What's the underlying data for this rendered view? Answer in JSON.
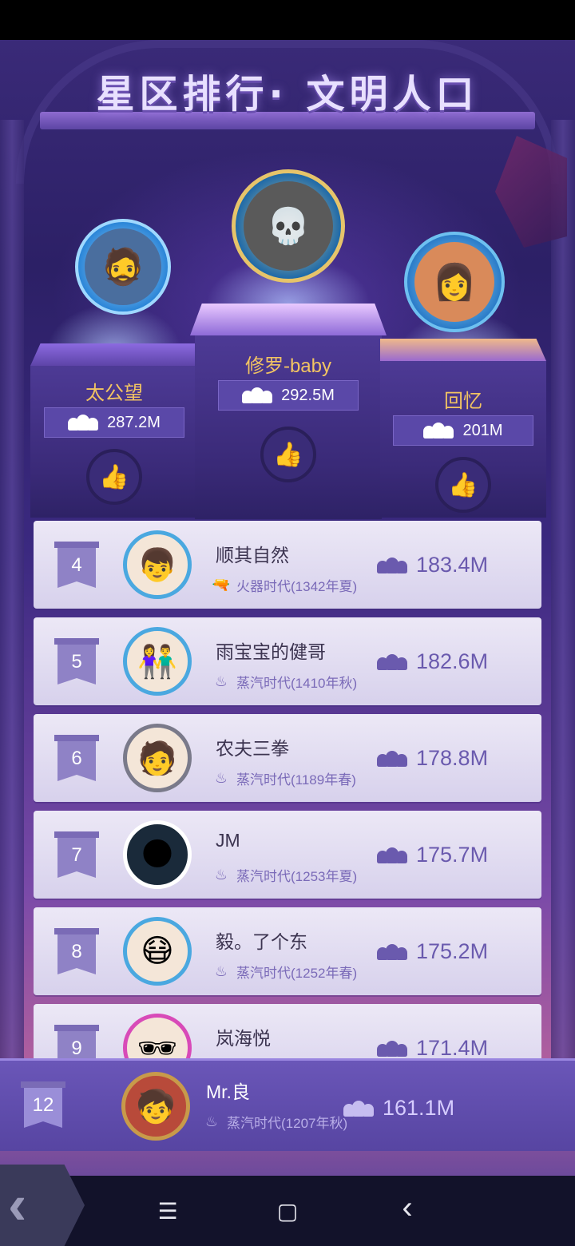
{
  "title": "星区排行· 文明人口",
  "podium": [
    {
      "rank": 2,
      "name": "太公望",
      "score": "287.2M",
      "avatar_glyph": "🧔",
      "name_color": "#f2c462"
    },
    {
      "rank": 1,
      "name": "修罗-baby",
      "score": "292.5M",
      "avatar_glyph": "💀",
      "name_color": "#f2c462"
    },
    {
      "rank": 3,
      "name": "回忆",
      "score": "201M",
      "avatar_glyph": "👩",
      "name_color": "#f2c462"
    }
  ],
  "list": [
    {
      "rank": "4",
      "name": "顺其自然",
      "era": "火器时代(1342年夏)",
      "era_icon": "gun-icon",
      "era_glyph": "🔫",
      "score": "183.4M",
      "avatar_glyph": "👦"
    },
    {
      "rank": "5",
      "name": "雨宝宝的健哥",
      "era": "蒸汽时代(1410年秋)",
      "era_icon": "steam-icon",
      "era_glyph": "♨",
      "score": "182.6M",
      "avatar_glyph": "👫"
    },
    {
      "rank": "6",
      "name": "农夫三拳",
      "era": "蒸汽时代(1189年春)",
      "era_icon": "steam-icon",
      "era_glyph": "♨",
      "score": "178.8M",
      "avatar_glyph": "🧑"
    },
    {
      "rank": "7",
      "name": "JM",
      "era": "蒸汽时代(1253年夏)",
      "era_icon": "steam-icon",
      "era_glyph": "♨",
      "score": "175.7M",
      "avatar_glyph": "🌑"
    },
    {
      "rank": "8",
      "name": "毅。了个东",
      "era": "蒸汽时代(1252年春)",
      "era_icon": "steam-icon",
      "era_glyph": "♨",
      "score": "175.2M",
      "avatar_glyph": "😷"
    },
    {
      "rank": "9",
      "name": "岚海悦",
      "era": "",
      "era_icon": "",
      "era_glyph": "",
      "score": "171.4M",
      "avatar_glyph": "🕶"
    }
  ],
  "self": {
    "rank": "12",
    "name": "Mr.良",
    "era": "蒸汽时代(1207年秋)",
    "era_icon": "steam-icon",
    "era_glyph": "♨",
    "score": "161.1M",
    "avatar_glyph": "🧒"
  },
  "nav": {
    "menu": "☰",
    "home": "▢",
    "back": "‹"
  },
  "back_glyph": "‹",
  "colors": {
    "accent": "#5a48a8",
    "gold": "#f2c462",
    "list_bg": "#e4dff2",
    "rank_text": "#6a5aae"
  }
}
